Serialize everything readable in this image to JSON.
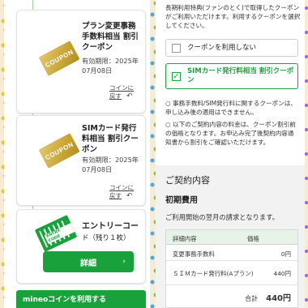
{
  "left": {
    "coupons": [
      {
        "title": [
          "プラン変更事務",
          "手数料相当 割引",
          "クーポン"
        ],
        "tag_text": "COUPON",
        "expiry_label": "有効期限：2025年",
        "expiry_date": "07月08日",
        "back_link": [
          "コインに",
          "戻す"
        ]
      },
      {
        "title": [
          "SIMカード発行",
          "料相当 割引クー",
          "ポン"
        ],
        "tag_text": "COUPON",
        "expiry_label": "有効期限：2025年",
        "expiry_date": "07月08日",
        "back_link": [
          "コインに",
          "戻す"
        ]
      }
    ],
    "entry_code": {
      "title": "エントリーコー",
      "title2": "ド（残り１枚）",
      "icon_label": "ENTRY CODE",
      "button": "詳細",
      "button_icon": "›"
    },
    "mineo_bar": "mineoコインを利用する"
  },
  "right": {
    "intro": "長期利用特典(ファンのとく)で取得したクーポンがご利用いただけます。利用するクーポンを選択してください。",
    "options": [
      {
        "label": "クーポンを利用しない",
        "selected": false
      },
      {
        "label": "SIMカード発行料相当 割引クーポン",
        "selected": true
      }
    ],
    "notes": [
      "○ 事務手数料/SIM発行料に関するクーポンは、申し込み後の適用はできません。",
      "○ 以下のご契約内容の料金は、クーポン割引前の価格となります。お申込み完了後契約内容通知書から割引をご確認いただけます。"
    ],
    "section_title": "ご契約内容",
    "section_sub": "初期費用",
    "section_desc": "ご利用開始の翌月の請求となります。",
    "table": {
      "headers": [
        "詳細内容",
        "価格"
      ],
      "rows": [
        {
          "name": "変更事務手数料",
          "price": "0円"
        },
        {
          "name": "ＳＩＭカード発行料(Aプラン)",
          "price": "440円"
        }
      ],
      "total_label": "合計",
      "total_value": "440円"
    }
  },
  "colors": {
    "accent": "#19a23c",
    "gold": "#c9a536",
    "background": "#f6ecd3"
  }
}
